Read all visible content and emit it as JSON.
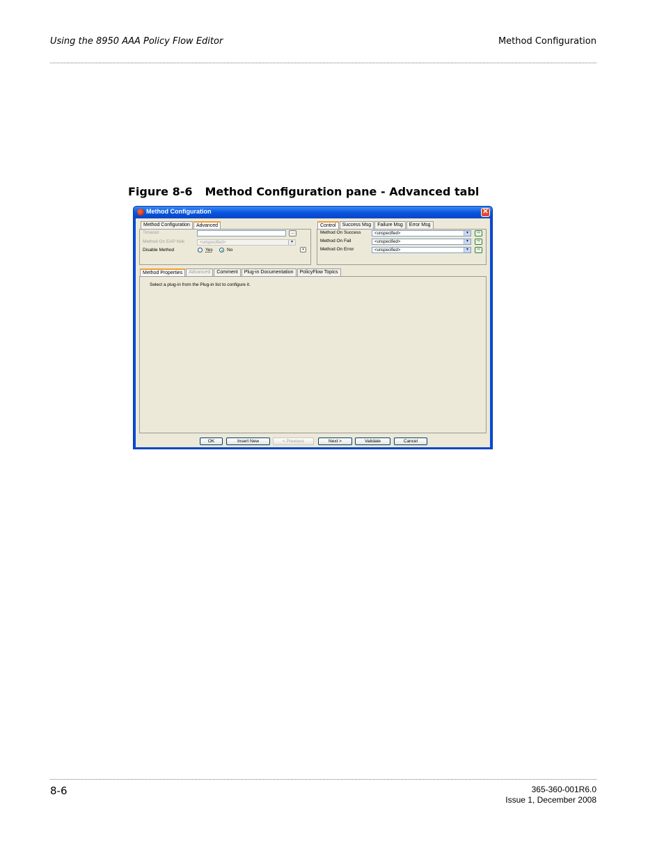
{
  "header": {
    "left": "Using the 8950 AAA Policy Flow Editor",
    "right": "Method Configuration"
  },
  "figure": {
    "number": "Figure 8-6",
    "title": "Method Configuration pane - Advanced tabl"
  },
  "window": {
    "title": "Method Configuration",
    "close": "✕",
    "left_tabs": [
      "Method Configuration",
      "Advanced"
    ],
    "timeout_label": "Timeout",
    "timeout_value": "",
    "browse": "...",
    "eap_nak_label": "Method On EAP Nak",
    "eap_nak_value": "<unspecified>",
    "disable_label": "Disable Method",
    "yes_label": "Yes",
    "no_label": "No",
    "right_tabs": [
      "Control",
      "Success Msg",
      "Failure Msg",
      "Error Msg"
    ],
    "control_rows": [
      {
        "label": "Method On Success",
        "value": "<unspecified>"
      },
      {
        "label": "Method On Fail",
        "value": "<unspecified>"
      },
      {
        "label": "Method On Error",
        "value": "<unspecified>"
      }
    ],
    "bottom_tabs": [
      "Method Properties",
      "Advanced",
      "Comment",
      "Plug-in Documentation",
      "PolicyFlow Topics"
    ],
    "info_text": "Select a plug-in from the Plug-in list to configure it.",
    "buttons": {
      "ok": "OK",
      "insert_new": "Insert New",
      "previous": "< Previous",
      "next": "Next >",
      "validate": "Validate",
      "cancel": "Cancel"
    }
  },
  "footer": {
    "page": "8-6",
    "doc_number": "365-360-001R6.0",
    "issue": "Issue 1, December 2008"
  }
}
